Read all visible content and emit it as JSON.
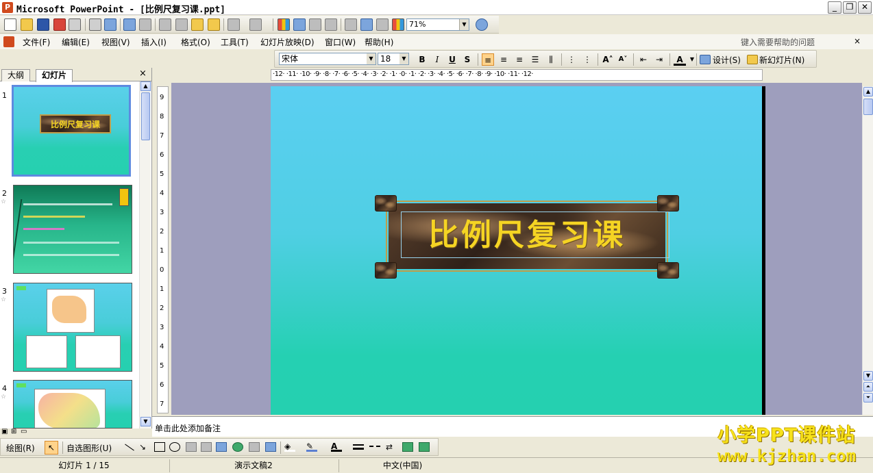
{
  "window": {
    "title": "Microsoft PowerPoint - [比例尺复习课.ppt]",
    "controls": {
      "minimize": "_",
      "restore": "❐",
      "close": "✕"
    }
  },
  "standard_toolbar": {
    "zoom": "71%"
  },
  "menu": {
    "items": [
      "文件(F)",
      "编辑(E)",
      "视图(V)",
      "插入(I)",
      "格式(O)",
      "工具(T)",
      "幻灯片放映(D)",
      "窗口(W)",
      "帮助(H)"
    ],
    "help_placeholder": "键入需要帮助的问题",
    "close_doc": "×"
  },
  "format_toolbar": {
    "font": "宋体",
    "size": "18",
    "bold": "B",
    "italic": "I",
    "underline": "U",
    "shadow": "S",
    "font_color": "A",
    "design": "设计(S)",
    "new_slide": "新幻灯片(N)"
  },
  "ruler": {
    "horizontal": "·12·  ·11·  ·10·  ·9·  ·8·  ·7·  ·6·  ·5·  ·4·  ·3·  ·2·  ·1·  ·0·  ·1·  ·2·  ·3·  ·4·  ·5·  ·6·  ·7·  ·8·  ·9·  ·10·  ·11·  ·12·",
    "vertical": [
      "9",
      "8",
      "7",
      "6",
      "5",
      "4",
      "3",
      "2",
      "1",
      "0",
      "1",
      "2",
      "3",
      "4",
      "5",
      "6",
      "7"
    ]
  },
  "left_panel": {
    "tabs": [
      "大纲",
      "幻灯片"
    ],
    "active_tab": "幻灯片",
    "close": "×",
    "slides": [
      {
        "number": "1",
        "title": "比例尺复习课"
      },
      {
        "number": "2"
      },
      {
        "number": "3"
      },
      {
        "number": "4"
      }
    ]
  },
  "slide": {
    "title": "比例尺复习课"
  },
  "notes": {
    "placeholder": "单击此处添加备注"
  },
  "drawing_toolbar": {
    "draw": "绘图(R)",
    "autoshapes": "自选图形(U)"
  },
  "status": {
    "slide": "幻灯片 1 / 15",
    "design": "演示文稿2",
    "language": "中文(中国)"
  },
  "watermark": {
    "line1": "小学PPT课件站",
    "line2": "www.kjzhan.com"
  },
  "colors": {
    "title_text": "#f5d423",
    "slide_top": "#5bcff2",
    "slide_bottom": "#25d0b0",
    "workspace": "#9e9ebd",
    "selection": "#5e8ae0"
  }
}
